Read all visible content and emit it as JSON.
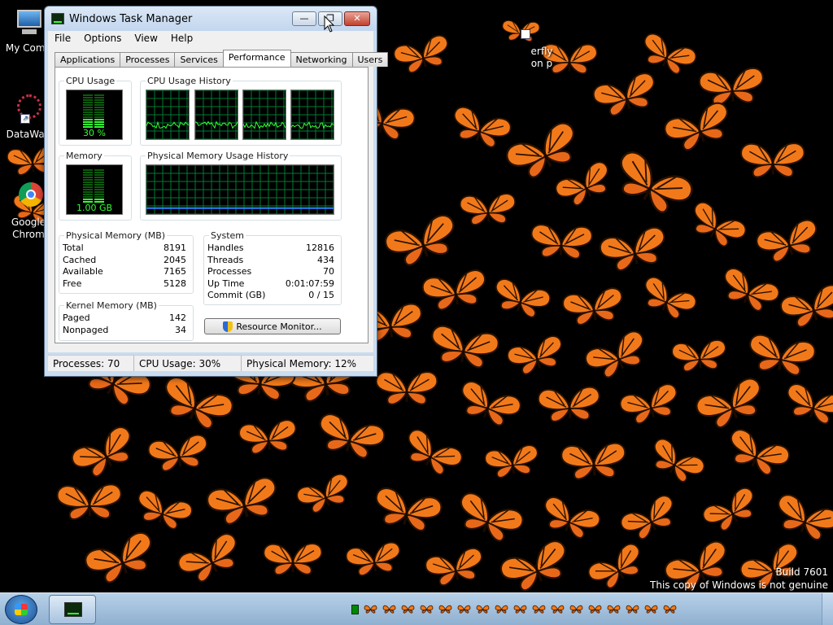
{
  "desktop": {
    "icons": [
      {
        "label": "My Comp"
      },
      {
        "label": "DataWag"
      },
      {
        "label": "Google Chrom"
      },
      {
        "label": "erfly on p"
      }
    ],
    "watermark_line1": "Build 7601",
    "watermark_line2": "This copy of Windows is not genuine"
  },
  "window": {
    "title": "Windows Task Manager",
    "minimize_label": "—",
    "maximize_label": "❐",
    "close_label": "✕",
    "menus": [
      "File",
      "Options",
      "View",
      "Help"
    ],
    "tabs": [
      "Applications",
      "Processes",
      "Services",
      "Performance",
      "Networking",
      "Users"
    ],
    "active_tab": "Performance"
  },
  "performance": {
    "cpu_usage_title": "CPU Usage",
    "cpu_usage_value": "30 %",
    "cpu_usage_fraction": 0.3,
    "cpu_history_title": "CPU Usage History",
    "memory_title": "Memory",
    "memory_value": "1.00 GB",
    "memory_fraction": 0.12,
    "phys_history_title": "Physical Memory Usage History",
    "physical_memory": {
      "title": "Physical Memory (MB)",
      "rows": [
        {
          "label": "Total",
          "value": "8191"
        },
        {
          "label": "Cached",
          "value": "2045"
        },
        {
          "label": "Available",
          "value": "7165"
        },
        {
          "label": "Free",
          "value": "5128"
        }
      ]
    },
    "kernel_memory": {
      "title": "Kernel Memory (MB)",
      "rows": [
        {
          "label": "Paged",
          "value": "142"
        },
        {
          "label": "Nonpaged",
          "value": "34"
        }
      ]
    },
    "system": {
      "title": "System",
      "rows": [
        {
          "label": "Handles",
          "value": "12816"
        },
        {
          "label": "Threads",
          "value": "434"
        },
        {
          "label": "Processes",
          "value": "70"
        },
        {
          "label": "Up Time",
          "value": "0:01:07:59"
        },
        {
          "label": "Commit (GB)",
          "value": "0 / 15"
        }
      ]
    },
    "resource_monitor_label": "Resource Monitor..."
  },
  "statusbar": {
    "processes": "Processes: 70",
    "cpu": "CPU Usage: 30%",
    "memory": "Physical Memory: 12%"
  },
  "colors": {
    "graph_line_green": "#33ff33",
    "graph_grid": "#007a33",
    "memory_line_blue": "#2f7fff",
    "butterfly_orange": "#f2791a"
  }
}
